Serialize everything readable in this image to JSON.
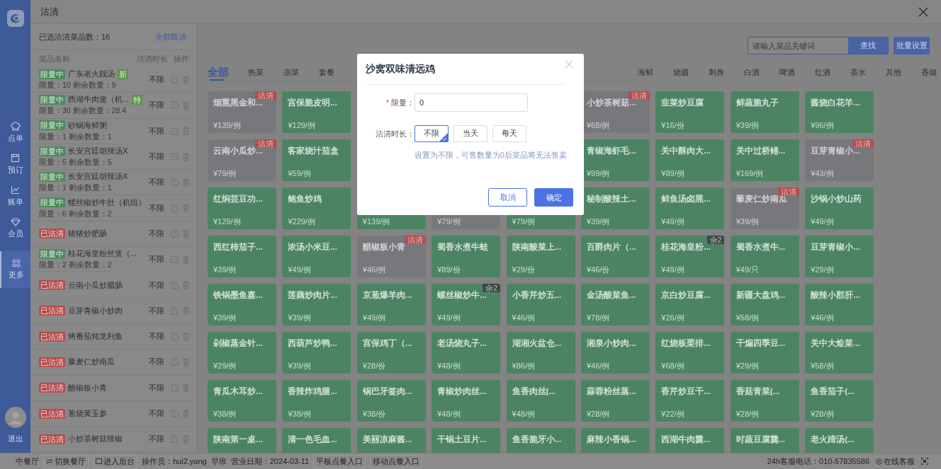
{
  "nav": {
    "items": [
      {
        "kind": "order",
        "label": "点单",
        "selected": false
      },
      {
        "kind": "booking",
        "label": "预订",
        "selected": false
      },
      {
        "kind": "bill",
        "label": "账单",
        "selected": false
      },
      {
        "kind": "member",
        "label": "会员",
        "selected": false
      },
      {
        "kind": "more",
        "label": "更多",
        "selected": true
      }
    ],
    "logout": "退出"
  },
  "header": {
    "title": "沽清"
  },
  "selection_panel": {
    "summary": "已选沽清菜品数：16",
    "clear_all": "全部取消",
    "columns": [
      "菜品名称",
      "沽清时长",
      "操作"
    ],
    "items": [
      {
        "kind": "limited",
        "status": "限量中",
        "name": "广东老火靓汤",
        "tag": "新",
        "detail": "限量：10  剩余数量：9",
        "duration": "不限"
      },
      {
        "kind": "limited",
        "status": "限量中",
        "name": "西湖牛肉羹（机...",
        "tag": "特",
        "detail": "限量：30  剩余数量：28.4",
        "duration": "不限"
      },
      {
        "kind": "limited",
        "status": "限量中",
        "name": "砂锅海鲜粥",
        "detail": "限量：1  剩余数量：1",
        "duration": "不限"
      },
      {
        "kind": "limited",
        "status": "限量中",
        "name": "长安宫廷胡辣汤X",
        "detail": "限量：5  剩余数量：5",
        "duration": "不限"
      },
      {
        "kind": "limited",
        "status": "限量中",
        "name": "长安宫廷胡辣汤X",
        "detail": "限量：1  剩余数量：1",
        "duration": "不限"
      },
      {
        "kind": "limited",
        "status": "限量中",
        "name": "螺丝椒炒牛肚（机组）",
        "detail": "限量：6  剩余数量：2",
        "duration": "不限"
      },
      {
        "kind": "sold_out",
        "status": "已沽清",
        "name": "猪猪炒肥肠",
        "duration": "不限"
      },
      {
        "kind": "limited",
        "status": "限量中",
        "name": "桂花海皇粉丝煲（...",
        "detail": "限量：2  剩余数量：2",
        "duration": "不限"
      },
      {
        "kind": "sold_out",
        "status": "已沽清",
        "name": "云南小瓜炒腊肠",
        "duration": "不限"
      },
      {
        "kind": "sold_out",
        "status": "已沽清",
        "name": "豆芽青椒小炒肉",
        "duration": "不限"
      },
      {
        "kind": "sold_out",
        "status": "已沽清",
        "name": "烤番茄炖龙利鱼",
        "duration": "不限"
      },
      {
        "kind": "sold_out",
        "status": "已沽清",
        "name": "藜麦仁炒南瓜",
        "duration": "不限"
      },
      {
        "kind": "sold_out",
        "status": "已沽清",
        "name": "醋椒板小青",
        "duration": "不限"
      },
      {
        "kind": "sold_out",
        "status": "已沽清",
        "name": "葱烧黄玉参",
        "duration": "不限"
      },
      {
        "kind": "sold_out",
        "status": "已沽清",
        "name": "小炒茶树菇辣椒",
        "duration": "不限"
      }
    ]
  },
  "toolbar": {
    "search_placeholder": "请输入菜品关键词",
    "search_button": "查找",
    "batch_button": "批量设置"
  },
  "categories": [
    {
      "kind": "tab",
      "label": "全部",
      "selected": true
    },
    {
      "kind": "tab",
      "label": "热菜",
      "selected": false
    },
    {
      "kind": "tab",
      "label": "凉菜",
      "selected": false
    },
    {
      "kind": "tab",
      "label": "套餐",
      "selected": false
    },
    {
      "kind": "covered"
    },
    {
      "kind": "covered"
    },
    {
      "kind": "covered"
    },
    {
      "kind": "covered"
    },
    {
      "kind": "covered"
    },
    {
      "kind": "covered"
    },
    {
      "kind": "covered"
    },
    {
      "kind": "covered"
    },
    {
      "kind": "tab",
      "label": "海鲜",
      "selected": false
    },
    {
      "kind": "tab",
      "label": "烧腊",
      "selected": false
    },
    {
      "kind": "tab",
      "label": "刺身",
      "selected": false
    },
    {
      "kind": "tab",
      "label": "白酒",
      "selected": false
    },
    {
      "kind": "tab",
      "label": "啤酒",
      "selected": false
    },
    {
      "kind": "tab",
      "label": "红酒",
      "selected": false
    },
    {
      "kind": "tab",
      "label": "茶水",
      "selected": false
    },
    {
      "kind": "tab",
      "label": "其他",
      "selected": false
    },
    {
      "kind": "tab",
      "label": "香烟",
      "selected": false
    }
  ],
  "dishes": [
    {
      "cards": [
        {
          "kind": "dish",
          "sold_out": true,
          "name": "烟熏黑金和...",
          "price": "¥139/例",
          "badge": {
            "kind": "sold_out",
            "text": "沽清"
          }
        },
        {
          "kind": "dish",
          "sold_out": false,
          "name": "宫保脆皮明...",
          "price": "¥129/例"
        },
        {
          "kind": "covered"
        },
        {
          "kind": "covered"
        },
        {
          "kind": "covered"
        },
        {
          "kind": "dish",
          "sold_out": true,
          "name": "小炒茶树菇...",
          "price": "¥68/例",
          "badge": {
            "kind": "sold_out",
            "text": "沽清"
          }
        },
        {
          "kind": "dish",
          "sold_out": false,
          "name": "韭菜炒豆腐",
          "price": "¥16/份"
        },
        {
          "kind": "dish",
          "sold_out": false,
          "name": "鲜蔬脆丸子",
          "price": "¥39/例"
        },
        {
          "kind": "dish",
          "sold_out": false,
          "name": "酱烧白花羊...",
          "price": "¥96/例"
        }
      ]
    },
    {
      "cards": [
        {
          "kind": "dish",
          "sold_out": true,
          "name": "云南小瓜炒...",
          "price": "¥79/例",
          "badge": {
            "kind": "sold_out",
            "text": "沽清"
          }
        },
        {
          "kind": "dish",
          "sold_out": false,
          "name": "客家烧汁茄盒",
          "price": "¥59/例"
        },
        {
          "kind": "covered"
        },
        {
          "kind": "covered"
        },
        {
          "kind": "covered"
        },
        {
          "kind": "dish",
          "sold_out": false,
          "name": "青椒海虾毛...",
          "price": "¥99/例"
        },
        {
          "kind": "dish",
          "sold_out": false,
          "name": "关中酥肉大...",
          "price": "¥89/例"
        },
        {
          "kind": "dish",
          "sold_out": false,
          "name": "关中过桥鳝...",
          "price": "¥169/例"
        },
        {
          "kind": "dish",
          "sold_out": true,
          "name": "豆芽青椒小...",
          "price": "¥43/例",
          "badge": {
            "kind": "sold_out",
            "text": "沽清"
          }
        }
      ]
    },
    {
      "cards": [
        {
          "kind": "dish",
          "sold_out": false,
          "name": "红焖芸豆功...",
          "price": "¥129/例"
        },
        {
          "kind": "dish",
          "sold_out": false,
          "name": "鲍鱼炒鸡",
          "price": "¥229/例"
        },
        {
          "kind": "dish",
          "sold_out": false,
          "price": "¥139/例"
        },
        {
          "kind": "dish",
          "sold_out": true,
          "price": "¥79/例"
        },
        {
          "kind": "dish",
          "sold_out": false,
          "price": "¥79/例"
        },
        {
          "kind": "dish",
          "sold_out": false,
          "name": "秘制酸辣土...",
          "price": "¥39/例"
        },
        {
          "kind": "dish",
          "sold_out": false,
          "name": "鲜鱼汤卤黑...",
          "price": "¥49/例"
        },
        {
          "kind": "dish",
          "sold_out": true,
          "name": "藜麦仁炒南瓜",
          "price": "¥39/例",
          "badge": {
            "kind": "sold_out",
            "text": "沽清"
          }
        },
        {
          "kind": "dish",
          "sold_out": false,
          "name": "沙锅小炒山药",
          "price": "¥49/例"
        }
      ]
    },
    {
      "cards": [
        {
          "kind": "dish",
          "sold_out": false,
          "name": "西红柿茄子...",
          "price": "¥39/例"
        },
        {
          "kind": "dish",
          "sold_out": false,
          "name": "浓汤小米豆...",
          "price": "¥49/例"
        },
        {
          "kind": "dish",
          "sold_out": true,
          "name": "醋椒板小青",
          "price": "¥46/例",
          "badge": {
            "kind": "sold_out",
            "text": "沽清"
          }
        },
        {
          "kind": "dish",
          "sold_out": false,
          "name": "蜀香水煮牛蛙",
          "price": "¥89/份"
        },
        {
          "kind": "dish",
          "sold_out": false,
          "name": "陕南酸菜上...",
          "price": "¥29/份"
        },
        {
          "kind": "dish",
          "sold_out": false,
          "name": "百爵肉片（...",
          "price": "¥46/份"
        },
        {
          "kind": "dish",
          "sold_out": false,
          "name": "桂花海皇粉...",
          "price": "¥49/例",
          "badge": {
            "kind": "remaining",
            "text": "余2"
          }
        },
        {
          "kind": "dish",
          "sold_out": false,
          "name": "蜀香水煮牛...",
          "price": "¥49/只"
        },
        {
          "kind": "dish",
          "sold_out": false,
          "name": "豆芽青椒小...",
          "price": "¥29/例"
        }
      ]
    },
    {
      "cards": [
        {
          "kind": "dish",
          "sold_out": false,
          "name": "铁锅墨鱼嘉...",
          "price": "¥39/例"
        },
        {
          "kind": "dish",
          "sold_out": false,
          "name": "莲藕炒肉片...",
          "price": "¥39/例"
        },
        {
          "kind": "dish",
          "sold_out": false,
          "name": "京葱爆羊肉...",
          "price": "¥49/例"
        },
        {
          "kind": "dish",
          "sold_out": false,
          "name": "螺丝椒炒牛...",
          "price": "¥49/例",
          "badge": {
            "kind": "remaining",
            "text": "余2"
          }
        },
        {
          "kind": "dish",
          "sold_out": false,
          "name": "小香芹炒五...",
          "price": "¥46/例"
        },
        {
          "kind": "dish",
          "sold_out": false,
          "name": "金汤酸菜鱼...",
          "price": "¥78/例"
        },
        {
          "kind": "dish",
          "sold_out": false,
          "name": "京白炒豆腐...",
          "price": "¥26/例"
        },
        {
          "kind": "dish",
          "sold_out": false,
          "name": "新疆大盘鸡...",
          "price": "¥58/例"
        },
        {
          "kind": "dish",
          "sold_out": false,
          "name": "酸辣小郡肝...",
          "price": "¥46/例"
        }
      ]
    },
    {
      "cards": [
        {
          "kind": "dish",
          "sold_out": false,
          "name": "剁椒蒸金针...",
          "price": "¥29/例"
        },
        {
          "kind": "dish",
          "sold_out": false,
          "name": "西葫芦炒鸭...",
          "price": "¥39/例"
        },
        {
          "kind": "dish",
          "sold_out": false,
          "name": "宫保鸡丁（...",
          "price": "¥28/份"
        },
        {
          "kind": "dish",
          "sold_out": false,
          "name": "老汤烧丸子...",
          "price": "¥48/例"
        },
        {
          "kind": "dish",
          "sold_out": false,
          "name": "湖湘火盆仓...",
          "price": "¥86/例"
        },
        {
          "kind": "dish",
          "sold_out": false,
          "name": "湘泉小炒肉...",
          "price": "¥46/例"
        },
        {
          "kind": "dish",
          "sold_out": false,
          "name": "红烧板栗排...",
          "price": "¥68/例"
        },
        {
          "kind": "dish",
          "sold_out": false,
          "name": "干煸四季豆...",
          "price": "¥29/例"
        },
        {
          "kind": "dish",
          "sold_out": false,
          "name": "关中大烩菜...",
          "price": "¥58/例"
        }
      ]
    },
    {
      "cards": [
        {
          "kind": "dish",
          "sold_out": false,
          "name": "青瓜木耳炒...",
          "price": "¥38/例"
        },
        {
          "kind": "dish",
          "sold_out": false,
          "name": "香辣炸鸡腿...",
          "price": "¥38/例"
        },
        {
          "kind": "dish",
          "sold_out": false,
          "name": "锅巴牙签肉...",
          "price": "¥38/份"
        },
        {
          "kind": "dish",
          "sold_out": false,
          "name": "青椒炒肉丝...",
          "price": "¥48/例"
        },
        {
          "kind": "dish",
          "sold_out": false,
          "name": "鱼香肉丝(...",
          "price": "¥48/例"
        },
        {
          "kind": "dish",
          "sold_out": false,
          "name": "蒜蓉粉丝蒸...",
          "price": "¥28/例"
        },
        {
          "kind": "dish",
          "sold_out": false,
          "name": "香芹炒豆干...",
          "price": "¥22/例"
        },
        {
          "kind": "dish",
          "sold_out": false,
          "name": "香菇青菜(...",
          "price": "¥28/例"
        },
        {
          "kind": "dish",
          "sold_out": false,
          "name": "鱼香茄子(...",
          "price": "¥28/例"
        }
      ]
    },
    {
      "cards": [
        {
          "kind": "dish",
          "sold_out": false,
          "name": "陕南第一桌..."
        },
        {
          "kind": "dish",
          "sold_out": false,
          "name": "清一色毛血..."
        },
        {
          "kind": "dish",
          "sold_out": false,
          "name": "美丽凉麻酱..."
        },
        {
          "kind": "dish",
          "sold_out": false,
          "name": "干锅土豆片..."
        },
        {
          "kind": "dish",
          "sold_out": false,
          "name": "鱼香脆牙小..."
        },
        {
          "kind": "dish",
          "sold_out": false,
          "name": "麻辣小香锅..."
        },
        {
          "kind": "dish",
          "sold_out": false,
          "name": "西湖牛肉羹..."
        },
        {
          "kind": "dish",
          "sold_out": false,
          "name": "时蔬豆腐羹..."
        },
        {
          "kind": "dish",
          "sold_out": false,
          "name": "老火蹄汤(..."
        }
      ]
    }
  ],
  "dialog": {
    "title": "沙窝双味清远鸡",
    "required_mark": "*",
    "limit_label": "限量：",
    "limit_value": "0",
    "duration_label": "沽清时长：",
    "duration_options": [
      {
        "label": "不限",
        "selected": true
      },
      {
        "label": "当天",
        "selected": false
      },
      {
        "label": "每天",
        "selected": false
      }
    ],
    "hint": "设置为不限，可售数量为0后菜品将无法售卖",
    "cancel": "取消",
    "confirm": "确定"
  },
  "status_bar": {
    "left": [
      {
        "kind": "text",
        "text": "中餐厅"
      },
      {
        "kind": "switch",
        "text": "切换餐厅"
      },
      {
        "kind": "backend",
        "text": "进入后台"
      },
      {
        "kind": "text",
        "text": "操作员：hui2.yang"
      },
      {
        "kind": "text",
        "text": "早班"
      },
      {
        "kind": "text",
        "text": "营业日期：2024-03-11"
      },
      {
        "kind": "link",
        "text": "平板点餐入口"
      },
      {
        "kind": "link",
        "text": "移动点餐入口"
      }
    ],
    "right": [
      {
        "kind": "text",
        "text": "24h客服电话：010-57835586"
      },
      {
        "kind": "service",
        "text": "在线客服"
      }
    ]
  }
}
